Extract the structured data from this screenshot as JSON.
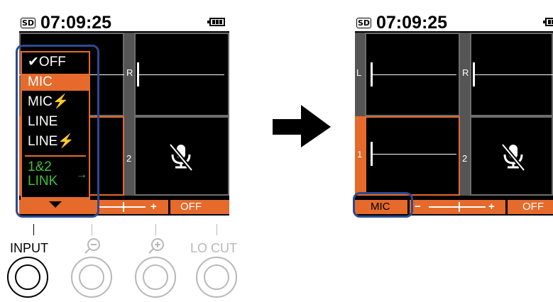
{
  "colors": {
    "accent": "#e56a2b",
    "highlight": "#2c4a92",
    "link_green": "#3fbf3f",
    "disabled": "#b8b8b8"
  },
  "left_screen": {
    "status": {
      "sd": "SD",
      "time": "07:09:25",
      "battery_icon": "battery-full-icon"
    },
    "channels": {
      "r": "R",
      "ch2": "2"
    },
    "menu": {
      "items": [
        {
          "label": "✔OFF",
          "checked": true
        },
        {
          "label": "MIC",
          "selected": true
        },
        {
          "label": "MIC⚡"
        },
        {
          "label": "LINE"
        },
        {
          "label": "LINE⚡"
        },
        {
          "label": "1&2\nLINK",
          "arrow": "→"
        }
      ],
      "down_icon": "triangle-down-icon"
    },
    "bottom": {
      "plus": "+",
      "locut": "OFF"
    },
    "mute_icon": "mic-muted-icon"
  },
  "arrow_icon": "right-arrow-icon",
  "right_screen": {
    "status": {
      "sd": "SD",
      "time": "07:09:25",
      "battery_icon": "battery-full-icon"
    },
    "channels": {
      "l": "L",
      "r": "R",
      "ch1": "1",
      "ch2": "2"
    },
    "bottom": {
      "input": "MIC",
      "minus": "−",
      "plus": "+",
      "locut": "OFF"
    },
    "mute_icon": "mic-muted-icon"
  },
  "buttons": [
    {
      "label": "INPUT",
      "icon": ""
    },
    {
      "label": "",
      "icon": "minus-zoom-icon"
    },
    {
      "label": "",
      "icon": "plus-zoom-icon"
    },
    {
      "label": "LO CUT",
      "icon": ""
    }
  ]
}
